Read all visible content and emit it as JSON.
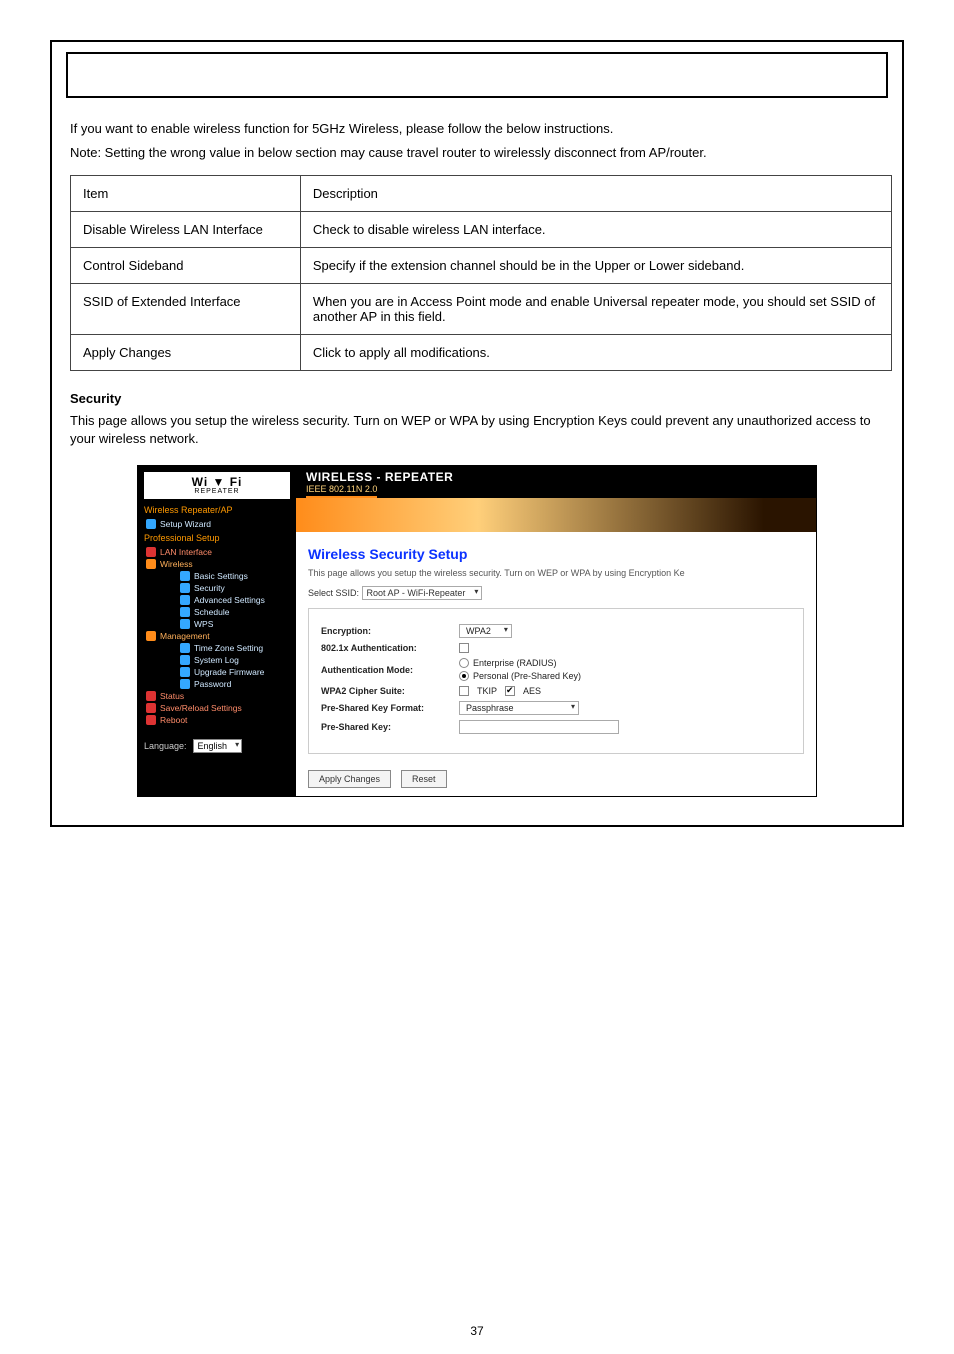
{
  "intro": {
    "p1": "If you want to enable wireless function for 5GHz Wireless, please follow the below instructions.",
    "p2": "Note: Setting the wrong value in below section may cause travel router to wirelessly disconnect from AP/router."
  },
  "table": {
    "r1": {
      "label": "Item",
      "desc": "Description"
    },
    "r2": {
      "label": "Disable Wireless LAN Interface",
      "desc": "Check to disable wireless LAN interface."
    },
    "r3": {
      "label": "Control Sideband",
      "desc": "Specify if the extension channel should be in the Upper or Lower sideband."
    },
    "r4": {
      "label": "SSID of Extended Interface",
      "desc": "When you are in Access Point mode and enable Universal repeater mode, you should set SSID of another AP in this field."
    },
    "r5": {
      "label": "Apply Changes",
      "desc": "Click to apply all modifications."
    }
  },
  "sec": {
    "title": "Security",
    "text": "This page allows you setup the wireless security. Turn on WEP or WPA by using Encryption Keys could prevent any unauthorized access to your wireless network."
  },
  "shot": {
    "brand": {
      "top": "Wi ▼ Fi",
      "sub": "REPEATER"
    },
    "navHead": "Wireless Repeater/AP",
    "nav": {
      "setup": "Setup Wizard",
      "profHead": "Professional Setup",
      "lan": "LAN Interface",
      "wireless": "Wireless",
      "basic": "Basic Settings",
      "security": "Security",
      "adv": "Advanced Settings",
      "sched": "Schedule",
      "wps": "WPS",
      "mgmt": "Management",
      "tz": "Time Zone Setting",
      "syslog": "System Log",
      "upg": "Upgrade Firmware",
      "pwd": "Password",
      "status": "Status",
      "save": "Save/Reload Settings",
      "reboot": "Reboot"
    },
    "lang": {
      "label": "Language:",
      "value": "English"
    },
    "hdr": {
      "title": "WIRELESS - REPEATER",
      "sub": "IEEE 802.11N 2.0"
    },
    "content": {
      "title": "Wireless Security Setup",
      "desc": "This page allows you setup the wireless security. Turn on WEP or WPA by using Encryption Ke",
      "ssidLabel": "Select SSID:",
      "ssidValue": "Root AP - WiFi-Repeater",
      "enc": {
        "label": "Encryption:",
        "value": "WPA2"
      },
      "dot1x": {
        "label": "802.1x Authentication:"
      },
      "authmode": {
        "label": "Authentication Mode:",
        "opt1": "Enterprise (RADIUS)",
        "opt2": "Personal (Pre-Shared Key)"
      },
      "cipher": {
        "label": "WPA2 Cipher Suite:",
        "opt1": "TKIP",
        "opt2": "AES"
      },
      "pskfmt": {
        "label": "Pre-Shared Key Format:",
        "value": "Passphrase"
      },
      "psk": {
        "label": "Pre-Shared Key:"
      },
      "apply": "Apply Changes",
      "reset": "Reset"
    }
  },
  "pageNum": "37"
}
